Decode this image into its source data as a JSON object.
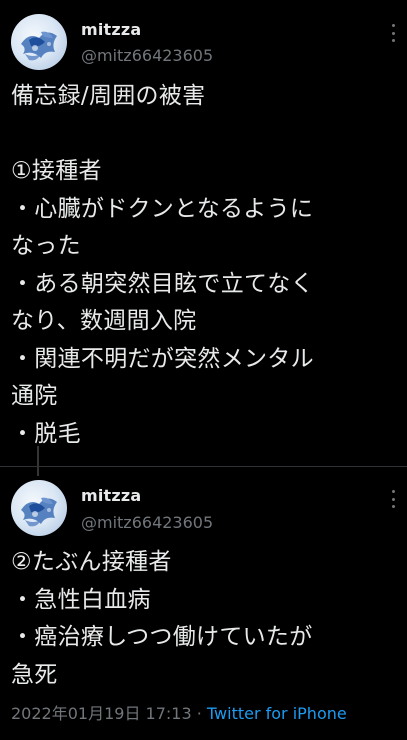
{
  "tweets": [
    {
      "display_name": "mitzza",
      "handle": "@mitz66423605",
      "avatar_icon": "avatar-image",
      "more_icon": "more-vertical-icon",
      "text": "備忘録/周囲の被害\n\n①接種者\n・心臓がドクンとなるように\nなった\n・ある朝突然目眩で立てなく\nなり、数週間入院\n・関連不明だが突然メンタル\n通院\n・脱毛"
    },
    {
      "display_name": "mitzza",
      "handle": "@mitz66423605",
      "avatar_icon": "avatar-image",
      "more_icon": "more-vertical-icon",
      "text": "②たぶん接種者\n・急性白血病\n・癌治療しつつ働けていたが\n急死",
      "timestamp": "2022年01月19日 17:13",
      "separator": " · ",
      "source": "Twitter for iPhone"
    }
  ],
  "colors": {
    "background": "#000000",
    "text_primary": "#e7e9ea",
    "text_secondary": "#71767b",
    "link": "#1d9bf0",
    "divider": "#2f3336"
  }
}
